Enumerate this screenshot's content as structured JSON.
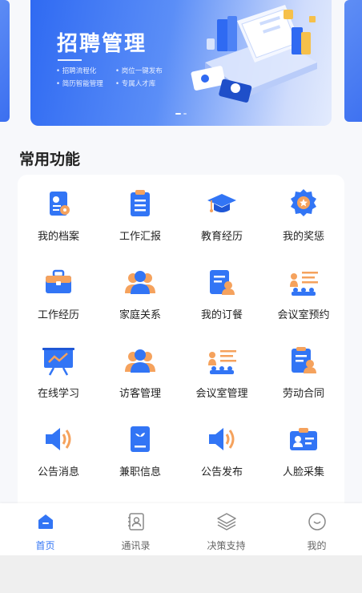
{
  "banner": {
    "title": "招聘管理",
    "bullets": [
      "招聘流程化",
      "岗位一键发布",
      "简历智能管理",
      "专属人才库"
    ]
  },
  "section": {
    "title": "常用功能"
  },
  "features": [
    {
      "label": "我的档案",
      "icon": "profile-icon"
    },
    {
      "label": "工作汇报",
      "icon": "report-icon"
    },
    {
      "label": "教育经历",
      "icon": "graduation-cap-icon"
    },
    {
      "label": "我的奖惩",
      "icon": "award-badge-icon"
    },
    {
      "label": "工作经历",
      "icon": "briefcase-icon"
    },
    {
      "label": "家庭关系",
      "icon": "family-icon"
    },
    {
      "label": "我的订餐",
      "icon": "meal-order-icon"
    },
    {
      "label": "会议室预约",
      "icon": "meeting-booking-icon"
    },
    {
      "label": "在线学习",
      "icon": "presentation-board-icon"
    },
    {
      "label": "访客管理",
      "icon": "visitor-icon"
    },
    {
      "label": "会议室管理",
      "icon": "meeting-room-icon"
    },
    {
      "label": "劳动合同",
      "icon": "contract-icon"
    },
    {
      "label": "公告消息",
      "icon": "speaker-icon"
    },
    {
      "label": "兼职信息",
      "icon": "part-time-doc-icon"
    },
    {
      "label": "公告发布",
      "icon": "announce-speaker-icon"
    },
    {
      "label": "人脸采集",
      "icon": "face-id-card-icon"
    }
  ],
  "tabs": [
    {
      "label": "首页",
      "icon": "home-icon",
      "active": true
    },
    {
      "label": "通讯录",
      "icon": "contacts-icon",
      "active": false
    },
    {
      "label": "决策支持",
      "icon": "layers-icon",
      "active": false
    },
    {
      "label": "我的",
      "icon": "smile-face-icon",
      "active": false
    }
  ],
  "colors": {
    "primary": "#3275f5",
    "orange": "#f5a25d",
    "text": "#222222"
  }
}
